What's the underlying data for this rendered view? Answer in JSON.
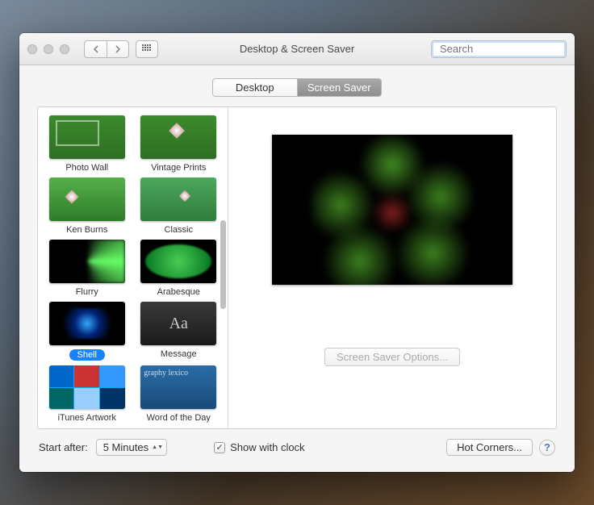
{
  "window": {
    "title": "Desktop & Screen Saver"
  },
  "search": {
    "placeholder": "Search"
  },
  "tabs": {
    "desktop": "Desktop",
    "screensaver": "Screen Saver"
  },
  "savers": [
    {
      "label": "Photo Wall"
    },
    {
      "label": "Vintage Prints"
    },
    {
      "label": "Ken Burns"
    },
    {
      "label": "Classic"
    },
    {
      "label": "Flurry"
    },
    {
      "label": "Arabesque"
    },
    {
      "label": "Shell",
      "selected": true
    },
    {
      "label": "Message",
      "glyph": "Aa"
    },
    {
      "label": "iTunes Artwork"
    },
    {
      "label": "Word of the Day",
      "glyph": "graphy\nlexico"
    }
  ],
  "options_button": "Screen Saver Options...",
  "bottom": {
    "start_after_label": "Start after:",
    "start_after_value": "5 Minutes",
    "show_clock": "Show with clock",
    "hot_corners": "Hot Corners..."
  }
}
